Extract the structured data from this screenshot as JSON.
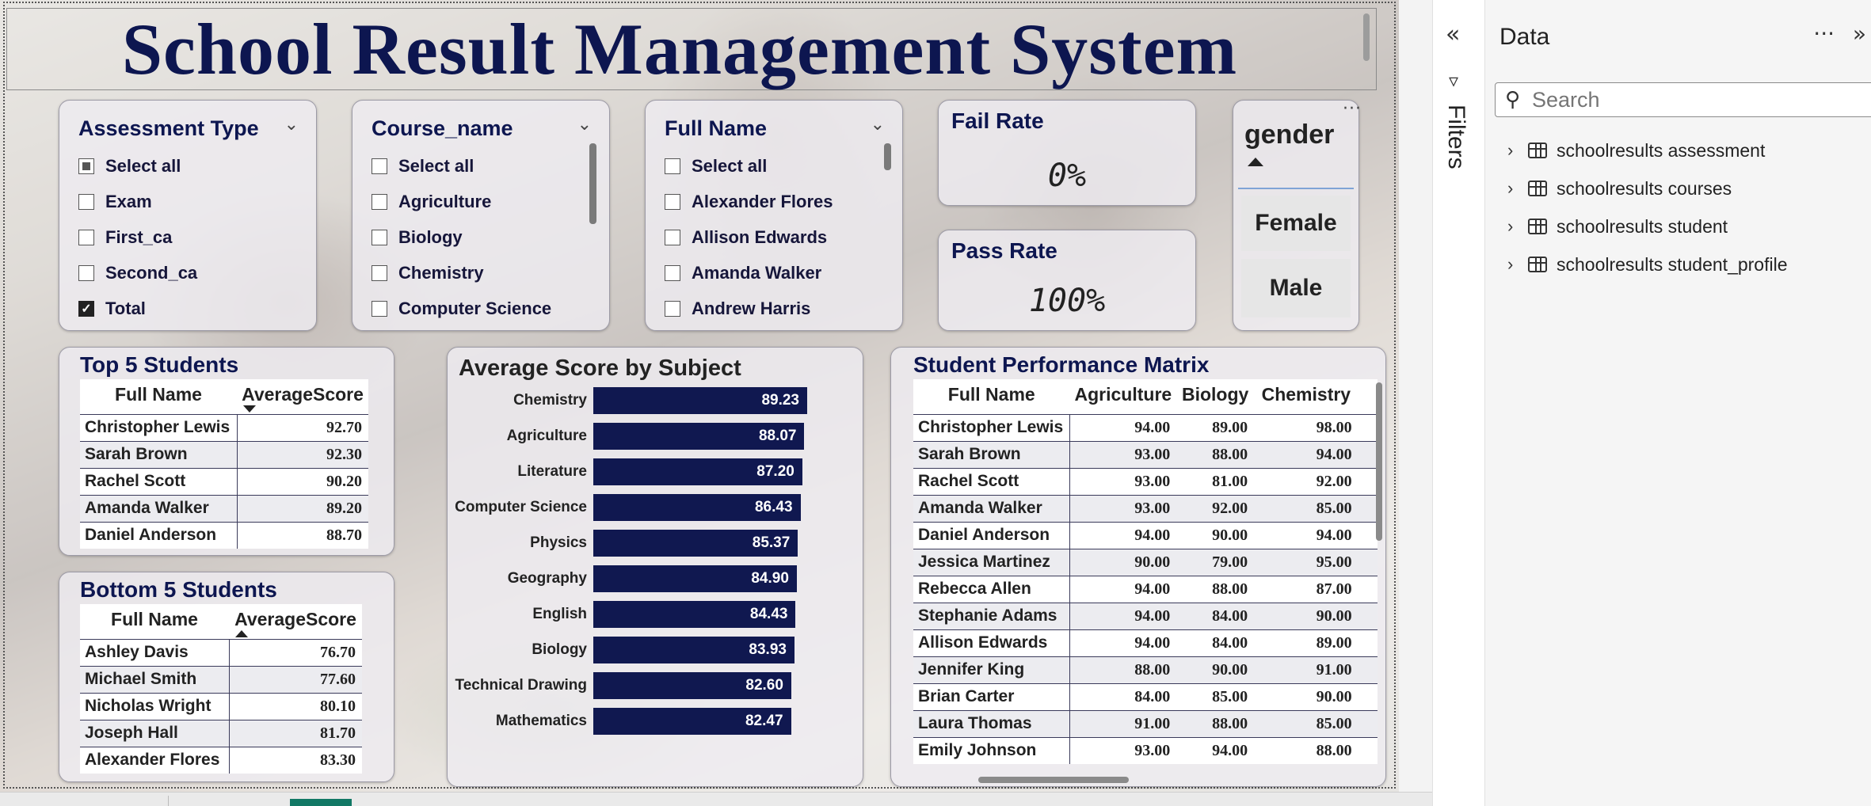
{
  "report": {
    "title": "School Result Management System"
  },
  "slicers": {
    "assessment": {
      "title": "Assessment Type",
      "items": [
        {
          "label": "Select all",
          "state": "partial"
        },
        {
          "label": "Exam",
          "state": "off"
        },
        {
          "label": "First_ca",
          "state": "off"
        },
        {
          "label": "Second_ca",
          "state": "off"
        },
        {
          "label": "Total",
          "state": "on"
        }
      ]
    },
    "course": {
      "title": "Course_name",
      "items": [
        {
          "label": "Select all",
          "state": "off"
        },
        {
          "label": "Agriculture",
          "state": "off"
        },
        {
          "label": "Biology",
          "state": "off"
        },
        {
          "label": "Chemistry",
          "state": "off"
        },
        {
          "label": "Computer Science",
          "state": "off"
        }
      ]
    },
    "fullname": {
      "title": "Full Name",
      "items": [
        {
          "label": "Select all",
          "state": "off"
        },
        {
          "label": "Alexander Flores",
          "state": "off"
        },
        {
          "label": "Allison Edwards",
          "state": "off"
        },
        {
          "label": "Amanda Walker",
          "state": "off"
        },
        {
          "label": "Andrew Harris",
          "state": "off"
        }
      ]
    },
    "gender": {
      "title": "gender",
      "options": [
        "Female",
        "Male"
      ]
    }
  },
  "kpis": {
    "fail": {
      "title": "Fail Rate",
      "value": "0%"
    },
    "pass": {
      "title": "Pass Rate",
      "value": "100%"
    }
  },
  "top5": {
    "title": "Top 5 Students",
    "columns": [
      "Full Name",
      "AverageScore"
    ],
    "rows": [
      [
        "Christopher Lewis",
        "92.70"
      ],
      [
        "Sarah Brown",
        "92.30"
      ],
      [
        "Rachel Scott",
        "90.20"
      ],
      [
        "Amanda Walker",
        "89.20"
      ],
      [
        "Daniel Anderson",
        "88.70"
      ]
    ]
  },
  "bottom5": {
    "title": "Bottom 5 Students",
    "columns": [
      "Full Name",
      "AverageScore"
    ],
    "rows": [
      [
        "Ashley Davis",
        "76.70"
      ],
      [
        "Michael Smith",
        "77.60"
      ],
      [
        "Nicholas Wright",
        "80.10"
      ],
      [
        "Joseph Hall",
        "81.70"
      ],
      [
        "Alexander Flores",
        "83.30"
      ]
    ]
  },
  "chart_data": {
    "type": "bar",
    "orientation": "horizontal",
    "title": "Average Score by Subject",
    "categories": [
      "Chemistry",
      "Agriculture",
      "Literature",
      "Computer Science",
      "Physics",
      "Geography",
      "English",
      "Biology",
      "Technical Drawing",
      "Mathematics"
    ],
    "values": [
      89.23,
      88.07,
      87.2,
      86.43,
      85.37,
      84.9,
      84.43,
      83.93,
      82.6,
      82.47
    ],
    "value_labels": [
      "89.23",
      "88.07",
      "87.20",
      "86.43",
      "85.37",
      "84.90",
      "84.43",
      "83.93",
      "82.60",
      "82.47"
    ],
    "xlim": [
      0,
      89.23
    ],
    "bar_color": "#101850",
    "grid": false
  },
  "matrix": {
    "title": "Student Performance Matrix",
    "columns": [
      "Full Name",
      "Agriculture",
      "Biology",
      "Chemistry"
    ],
    "rows": [
      [
        "Christopher Lewis",
        "94.00",
        "89.00",
        "98.00"
      ],
      [
        "Sarah Brown",
        "93.00",
        "88.00",
        "94.00"
      ],
      [
        "Rachel Scott",
        "93.00",
        "81.00",
        "92.00"
      ],
      [
        "Amanda Walker",
        "93.00",
        "92.00",
        "85.00"
      ],
      [
        "Daniel Anderson",
        "94.00",
        "90.00",
        "94.00"
      ],
      [
        "Jessica Martinez",
        "90.00",
        "79.00",
        "95.00"
      ],
      [
        "Rebecca Allen",
        "94.00",
        "88.00",
        "87.00"
      ],
      [
        "Stephanie Adams",
        "94.00",
        "84.00",
        "90.00"
      ],
      [
        "Allison Edwards",
        "94.00",
        "84.00",
        "89.00"
      ],
      [
        "Jennifer King",
        "88.00",
        "90.00",
        "91.00"
      ],
      [
        "Brian Carter",
        "84.00",
        "85.00",
        "90.00"
      ],
      [
        "Laura Thomas",
        "91.00",
        "88.00",
        "85.00"
      ],
      [
        "Emily Johnson",
        "93.00",
        "94.00",
        "88.00"
      ]
    ]
  },
  "panes": {
    "filters_label": "Filters",
    "data_title": "Data",
    "search_placeholder": "Search",
    "tables": [
      "schoolresults assessment",
      "schoolresults courses",
      "schoolresults student",
      "schoolresults student_profile"
    ]
  },
  "theme": {
    "accent": "#0d1650",
    "tab_active": "#117865"
  }
}
